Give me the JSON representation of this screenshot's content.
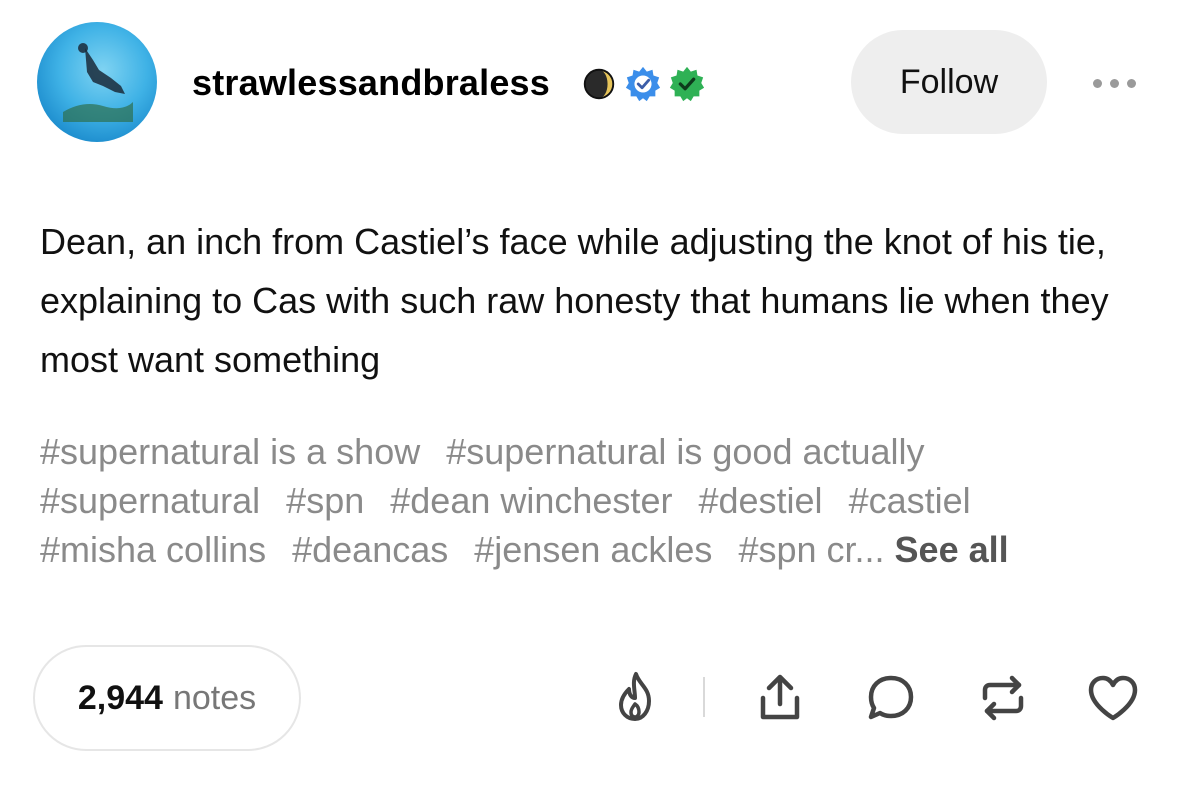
{
  "post": {
    "username": "strawlessandbraless",
    "follow_label": "Follow",
    "body": "Dean, an inch from Castiel’s face while adjusting the knot of his tie, explaining to Cas with such raw honesty that humans lie when they most want something",
    "tags": [
      "#supernatural is a show",
      "#supernatural is good actually",
      "#supernatural",
      "#spn",
      "#dean winchester",
      "#destiel",
      "#castiel",
      "#misha collins",
      "#deancas",
      "#jensen ackles"
    ],
    "truncated_tag": "#spn cr...",
    "see_all_label": "See all",
    "notes_count": "2,944",
    "notes_label": "notes"
  },
  "icons": {
    "badges": [
      "moon-badge-icon",
      "blue-check-badge-icon",
      "green-check-badge-icon"
    ],
    "actions": [
      "flame-icon",
      "share-icon",
      "reply-icon",
      "reblog-icon",
      "like-icon"
    ]
  },
  "colors": {
    "tag_text": "#8a8a8a",
    "blue_badge": "#3b8eea",
    "green_badge": "#2fb155",
    "follow_bg": "#eeeeee"
  }
}
